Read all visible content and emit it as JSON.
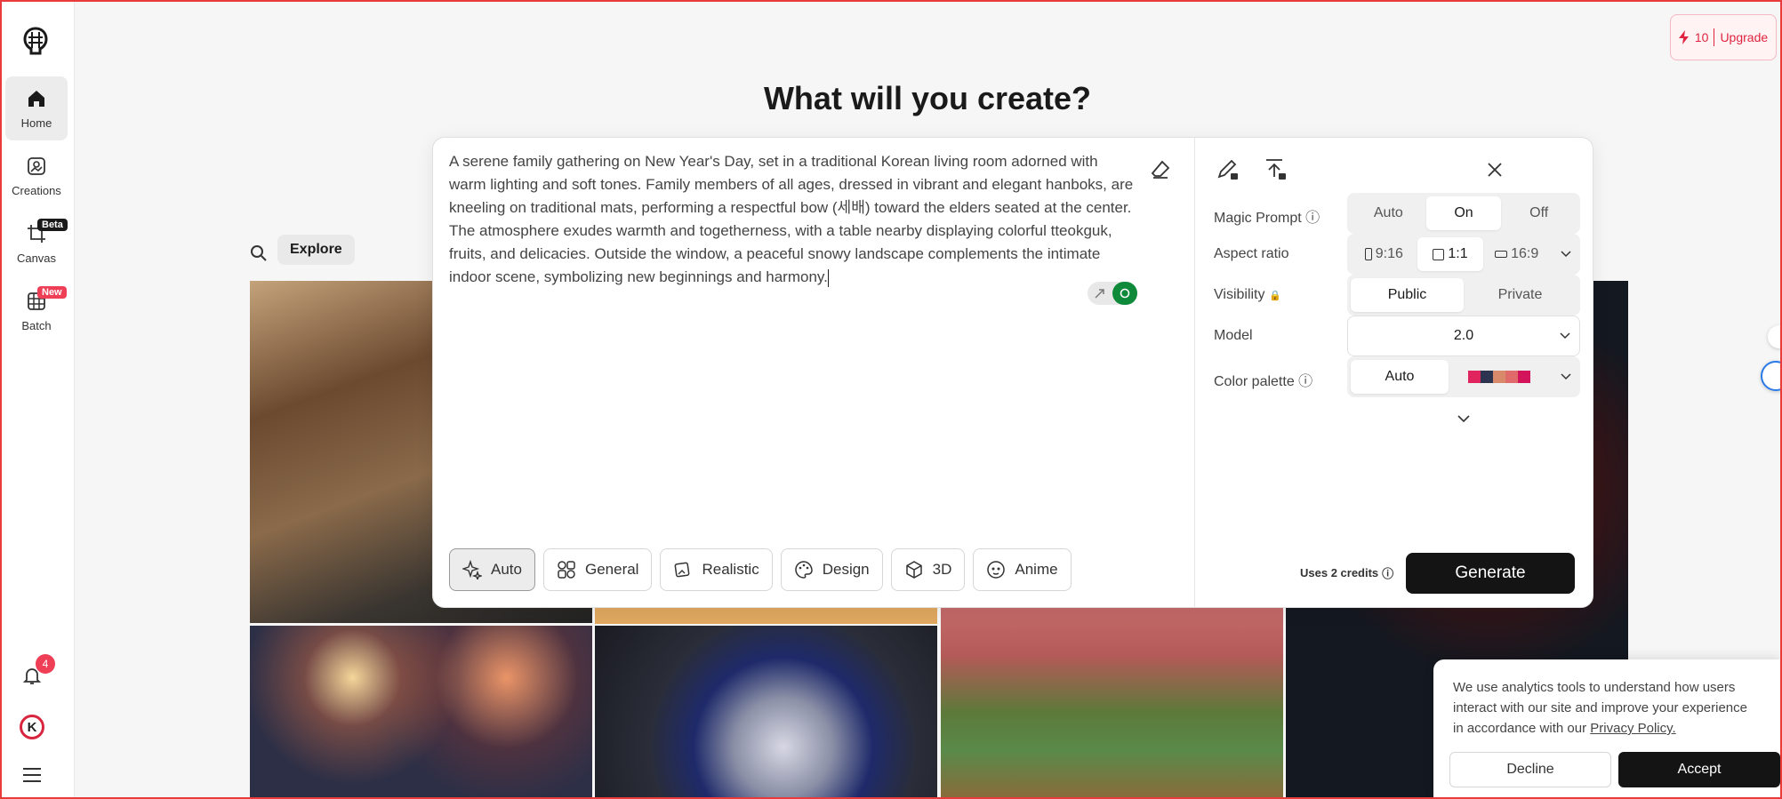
{
  "sidebar": {
    "logo_icon": "brain-logo-icon",
    "items": [
      {
        "label": "Home",
        "icon": "home-icon",
        "active": true
      },
      {
        "label": "Creations",
        "icon": "image-icon"
      },
      {
        "label": "Canvas",
        "icon": "crop-icon",
        "badge": "Beta"
      },
      {
        "label": "Batch",
        "icon": "grid-icon",
        "badge": "New"
      }
    ],
    "notification_count": "4",
    "avatar_letter": "K"
  },
  "header": {
    "credits": "10",
    "upgrade_label": "Upgrade",
    "title": "What will you create?"
  },
  "gallery": {
    "explore_label": "Explore"
  },
  "prompt": {
    "text": "A serene family gathering on New Year's Day, set in a traditional Korean living room adorned with warm lighting and soft tones. Family members of all ages, dressed in vibrant and elegant hanboks, are kneeling on traditional mats, performing a respectful bow (세배) toward the elders seated at the center. The atmosphere exudes warmth and togetherness, with a table nearby displaying colorful tteokguk, fruits, and delicacies. Outside the window, a peaceful snowy landscape complements the intimate indoor scene, symbolizing new beginnings and harmony."
  },
  "styles": [
    {
      "label": "Auto",
      "icon": "sparkle-icon",
      "active": true
    },
    {
      "label": "General",
      "icon": "grid-shapes-icon"
    },
    {
      "label": "Realistic",
      "icon": "photo-icon"
    },
    {
      "label": "Design",
      "icon": "palette-icon"
    },
    {
      "label": "3D",
      "icon": "cube-icon"
    },
    {
      "label": "Anime",
      "icon": "face-icon"
    }
  ],
  "settings": {
    "magic_prompt": {
      "label": "Magic Prompt",
      "options": [
        "Auto",
        "On",
        "Off"
      ],
      "selected": "On"
    },
    "aspect_ratio": {
      "label": "Aspect ratio",
      "options": [
        "9:16",
        "1:1",
        "16:9"
      ],
      "selected": "1:1"
    },
    "visibility": {
      "label": "Visibility",
      "options": [
        "Public",
        "Private"
      ],
      "selected": "Public"
    },
    "model": {
      "label": "Model",
      "value": "2.0"
    },
    "color_palette": {
      "label": "Color palette",
      "value": "Auto",
      "swatches": [
        "#e0245e",
        "#2c3450",
        "#d88a6a",
        "#e06a6a",
        "#d4145a"
      ]
    },
    "credits_note": "Uses 2 credits",
    "generate_label": "Generate"
  },
  "cookie": {
    "text": "We use analytics tools to understand how users interact with our site and improve your experience in accordance with our",
    "link": "Privacy Policy.",
    "decline": "Decline",
    "accept": "Accept"
  }
}
